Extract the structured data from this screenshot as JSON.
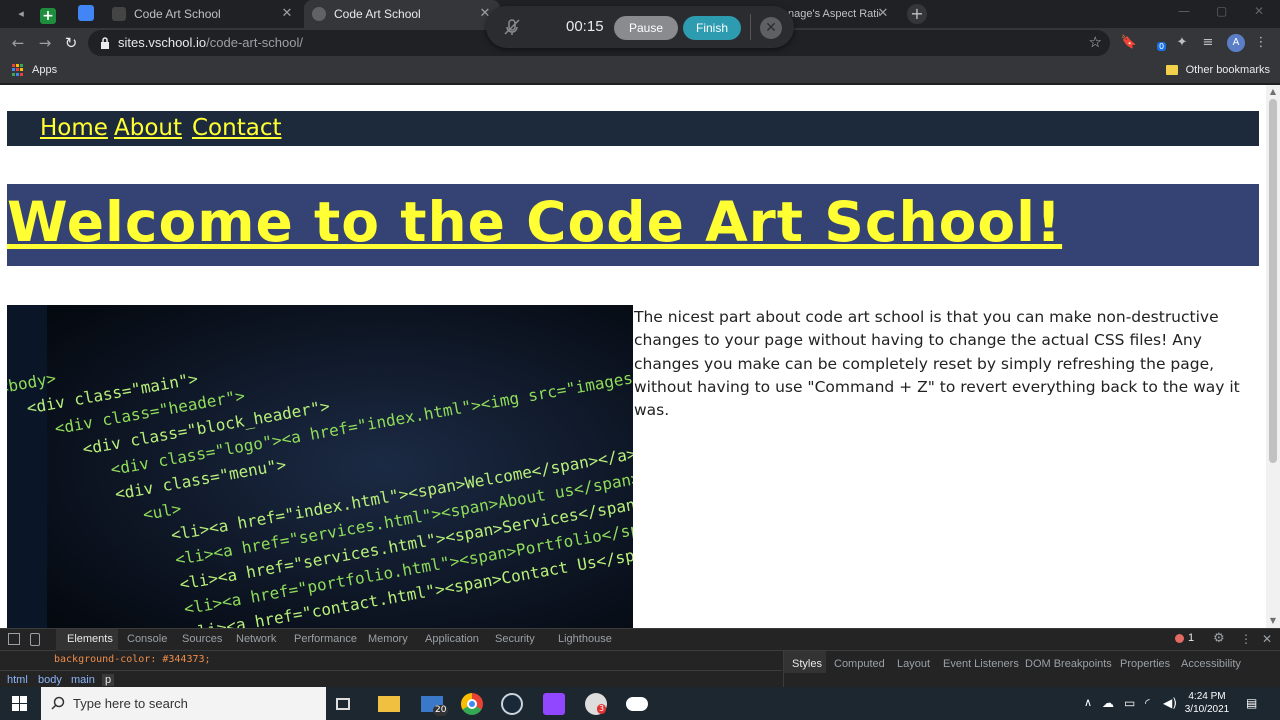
{
  "browser": {
    "tabs": [
      {
        "title": "Code Art School",
        "active": false
      },
      {
        "title": "Code Art School",
        "active": true
      },
      {
        "title": "nage's Aspect Ratio",
        "active": false
      }
    ],
    "new_tab_icon": "+",
    "url_host": "sites.vschool.io",
    "url_path": "/code-art-school/",
    "extension_badge": "0",
    "profile_initial": "A",
    "bookmarks": {
      "apps_label": "Apps",
      "other_label": "Other bookmarks"
    }
  },
  "recorder": {
    "timer": "00:15",
    "pause_label": "Pause",
    "finish_label": "Finish"
  },
  "page": {
    "nav": [
      "Home",
      "About",
      "Contact"
    ],
    "heading": "Welcome to the Code Art School!",
    "paragraph": "The nicest part about code art school is that you can make non-destructive changes to your page without having to change the actual CSS files! Any changes you make can be completely reset by simply refreshing the page, without having to use \"Command + Z\" to revert everything back to the way it was.",
    "image_code_lines": [
      "<body>",
      "<div class=\"main\">",
      "<div class=\"header\">",
      "<div class=\"block_header\">",
      "<div class=\"logo\"><a href=\"index.html\"><img src=\"images/logo.gif\"",
      "<div class=\"menu\">",
      "<ul>",
      "<li><a href=\"index.html\"><span>Welcome</span></a></li>",
      "<li><a href=\"services.html\"><span>About us</span></a></li>",
      "<li><a href=\"services.html\"><span>Services</span></a></li>",
      "<li><a href=\"portfolio.html\"><span>Portfolio</span></a></li>",
      "<li><a href=\"contact.html\"><span>Contact Us</span></a></li>"
    ],
    "colors": {
      "nav_bg": "#1d2a3c",
      "hero_bg": "#344373",
      "link": "#ffff33"
    }
  },
  "devtools": {
    "tabs": [
      "Elements",
      "Console",
      "Sources",
      "Network",
      "Performance",
      "Memory",
      "Application",
      "Security",
      "Lighthouse"
    ],
    "active_tab": "Elements",
    "error_count": "1",
    "css_line": "background-color: #344373;",
    "breadcrumbs": [
      "html",
      "body",
      "main",
      "p"
    ],
    "side_tabs": [
      "Styles",
      "Computed",
      "Layout",
      "Event Listeners",
      "DOM Breakpoints",
      "Properties",
      "Accessibility"
    ]
  },
  "taskbar": {
    "search_placeholder": "Type here to search",
    "mail_badge": "20",
    "tray_badge": "3",
    "time": "4:24 PM",
    "date": "3/10/2021"
  }
}
